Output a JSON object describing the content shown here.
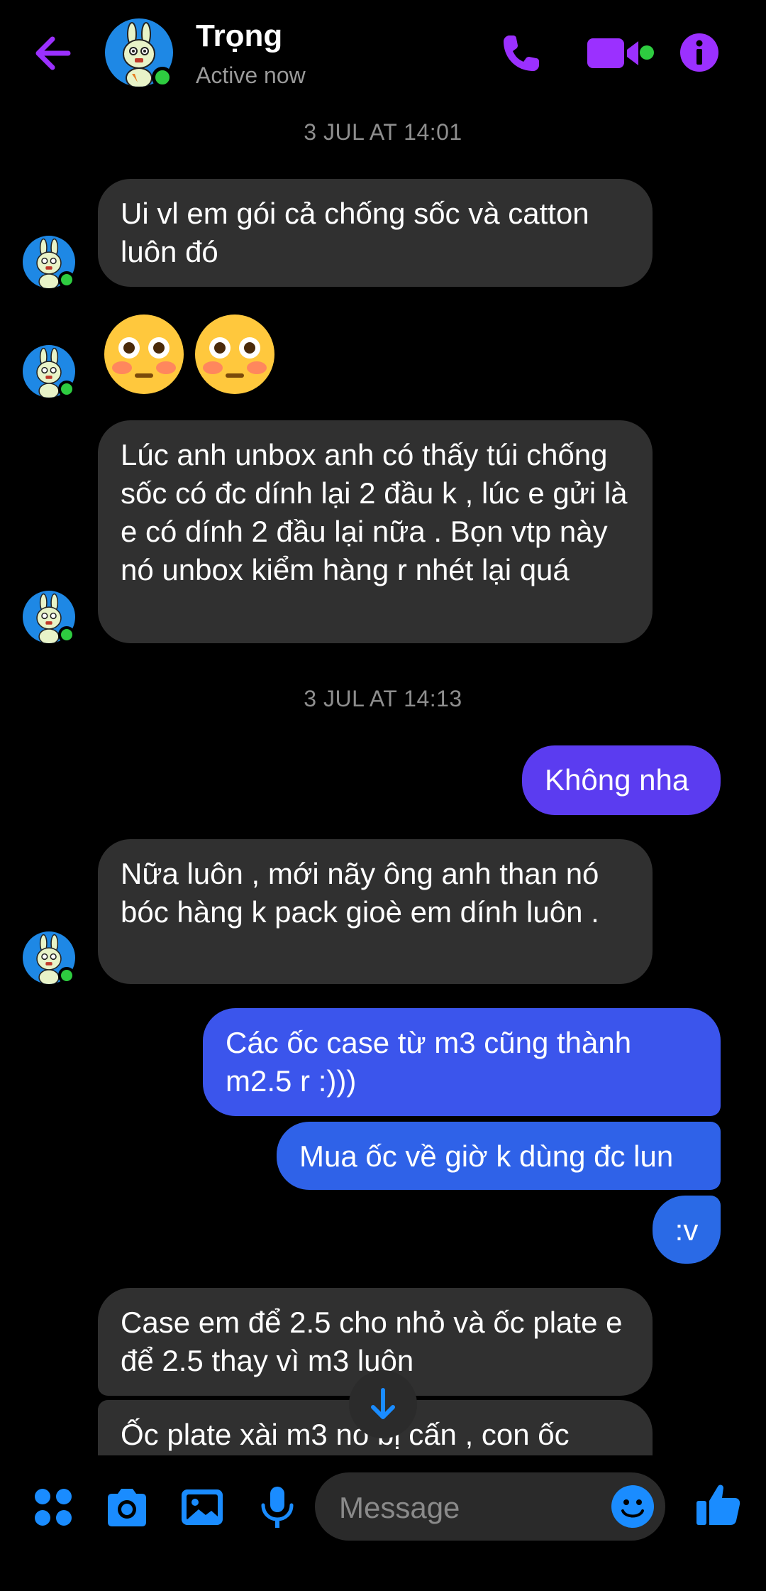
{
  "colors": {
    "accent": "#9b30ff",
    "outgoing_purple": "#5b3cf0",
    "outgoing_blue": "#2f62e8",
    "incoming": "#303030",
    "online": "#2ecc40",
    "composer_blue": "#1a8cff"
  },
  "header": {
    "contact_name": "Trọng",
    "status": "Active now",
    "icons": [
      "back-arrow-icon",
      "phone-icon",
      "video-camera-icon",
      "info-icon"
    ]
  },
  "messages": {
    "ts1": "3 JUL AT 14:01",
    "m1": "Ui vl em gói cả chống sốc và catton luôn đó",
    "m3": "Lúc anh unbox anh có thấy túi chống sốc có đc dính lại 2 đầu k , lúc e gửi là e có dính 2 đầu lại nữa . Bọn vtp này nó unbox kiểm hàng r nhét lại quá",
    "ts2": "3 JUL AT 14:13",
    "m4": "Không nha",
    "m5": "Nữa luôn , mới nãy ông anh than nó bóc hàng k pack gioè em dính luôn .",
    "m6": "Các ốc case từ m3 cũng thành m2.5 r :)))",
    "m7": "Mua ốc về giờ k dùng đc lun",
    "m8": ":v",
    "m9": "Case em để 2.5 cho nhỏ và ốc plate e để 2.5 thay vì m3 luôn",
    "m10": "Ốc plate xài m3 nó bị cấn , con ốc"
  },
  "composer": {
    "placeholder": "Message",
    "icons": [
      "apps-icon",
      "camera-icon",
      "gallery-icon",
      "microphone-icon",
      "emoji-icon",
      "thumbs-up-icon"
    ]
  }
}
